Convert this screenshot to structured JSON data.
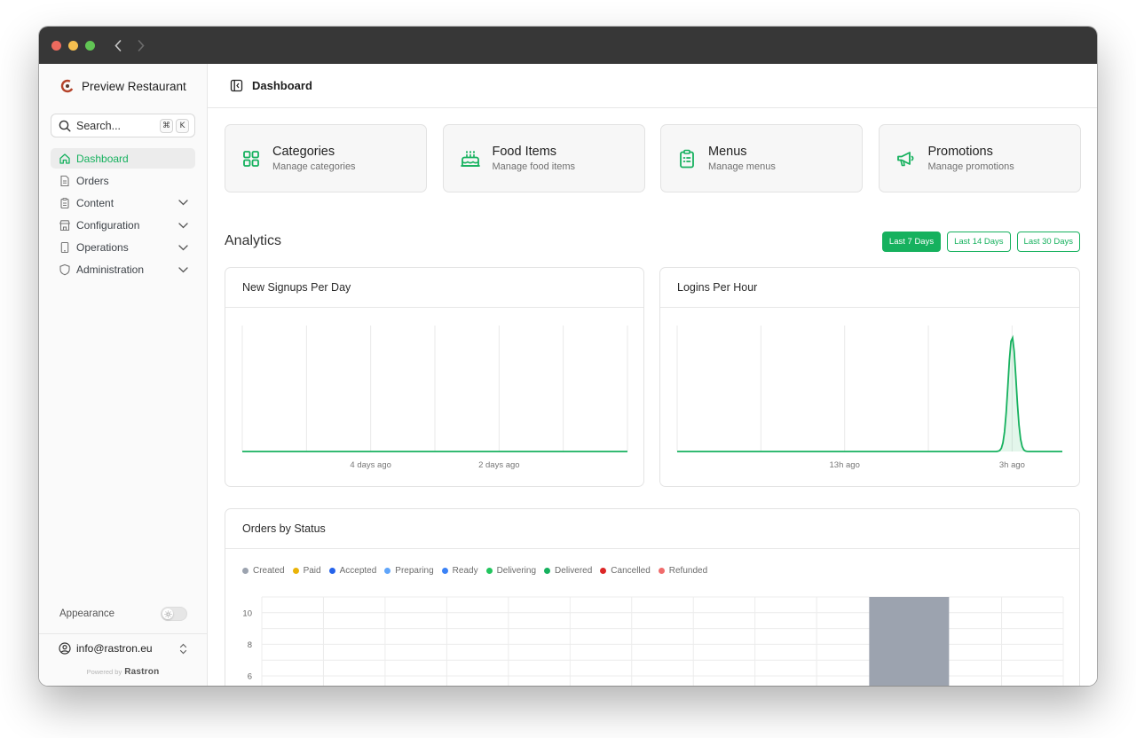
{
  "window": {
    "controls": [
      "close",
      "minimize",
      "zoom"
    ]
  },
  "sidebar": {
    "brand": "Preview Restaurant",
    "search": {
      "placeholder": "Search...",
      "shortcut_mod": "⌘",
      "shortcut_key": "K"
    },
    "items": [
      {
        "label": "Dashboard",
        "icon": "home-icon",
        "active": true,
        "expandable": false
      },
      {
        "label": "Orders",
        "icon": "document-icon",
        "active": false,
        "expandable": false
      },
      {
        "label": "Content",
        "icon": "clipboard-icon",
        "active": false,
        "expandable": true
      },
      {
        "label": "Configuration",
        "icon": "store-icon",
        "active": false,
        "expandable": true
      },
      {
        "label": "Operations",
        "icon": "device-icon",
        "active": false,
        "expandable": true
      },
      {
        "label": "Administration",
        "icon": "shield-icon",
        "active": false,
        "expandable": true
      }
    ],
    "appearance_label": "Appearance",
    "account_email": "info@rastron.eu",
    "powered_by": "Powered by",
    "powered_brand": "Rastron"
  },
  "header": {
    "title": "Dashboard"
  },
  "cards": [
    {
      "title": "Categories",
      "subtitle": "Manage categories",
      "icon": "grid-icon"
    },
    {
      "title": "Food Items",
      "subtitle": "Manage food items",
      "icon": "cake-icon"
    },
    {
      "title": "Menus",
      "subtitle": "Manage menus",
      "icon": "clipboard-list-icon"
    },
    {
      "title": "Promotions",
      "subtitle": "Manage promotions",
      "icon": "megaphone-icon"
    }
  ],
  "analytics": {
    "title": "Analytics",
    "ranges": [
      {
        "label": "Last 7 Days",
        "active": true
      },
      {
        "label": "Last 14 Days",
        "active": false
      },
      {
        "label": "Last 30 Days",
        "active": false
      }
    ]
  },
  "colors": {
    "accent": "#16b15e",
    "created": "#9ca3af",
    "paid": "#eab308",
    "accepted": "#2563eb",
    "preparing": "#60a5fa",
    "ready": "#3b82f6",
    "delivering": "#22c55e",
    "delivered": "#16b15e",
    "cancelled": "#dc2626",
    "refunded": "#f06b6b"
  },
  "chart_data": [
    {
      "type": "line",
      "title": "New Signups Per Day",
      "x": [
        0,
        1,
        2,
        3,
        4,
        5,
        6
      ],
      "tick_labels": [
        {
          "x": 2,
          "label": "4 days ago"
        },
        {
          "x": 4,
          "label": "2 days ago"
        }
      ],
      "series": [
        {
          "values": [
            0,
            0,
            0,
            0,
            0,
            0,
            0
          ]
        }
      ],
      "ylim": [
        0,
        10
      ],
      "grid": true
    },
    {
      "type": "area",
      "title": "Logins Per Hour",
      "x": [
        0,
        1,
        2,
        3,
        4,
        5,
        6,
        7,
        8,
        9,
        10,
        11,
        12,
        13,
        14,
        15,
        16,
        17,
        18,
        19,
        20,
        21,
        22,
        23
      ],
      "tick_labels": [
        {
          "x": 10,
          "label": "13h ago"
        },
        {
          "x": 20,
          "label": "3h ago"
        }
      ],
      "series": [
        {
          "values": [
            0,
            0,
            0,
            0,
            0,
            0,
            0,
            0,
            0,
            0,
            0,
            0,
            0,
            0,
            0,
            0,
            0,
            0,
            0,
            0,
            1,
            0,
            0,
            0
          ]
        }
      ],
      "ylim": [
        0,
        1.1
      ],
      "grid": true
    },
    {
      "type": "bar",
      "title": "Orders by Status",
      "legend": [
        "Created",
        "Paid",
        "Accepted",
        "Preparing",
        "Ready",
        "Delivering",
        "Delivered",
        "Cancelled",
        "Refunded"
      ],
      "legend_placement": "top-left",
      "categories": [
        0,
        1,
        2,
        3,
        4,
        5,
        6,
        7,
        8,
        9,
        10,
        11,
        12
      ],
      "series": [
        {
          "name": "Created",
          "values": [
            0,
            0,
            0,
            0,
            0,
            0,
            0,
            0,
            0,
            0,
            11,
            0,
            0
          ]
        }
      ],
      "y_ticks": [
        6,
        8,
        10
      ],
      "ylim": [
        0,
        11
      ],
      "grid": true
    }
  ]
}
